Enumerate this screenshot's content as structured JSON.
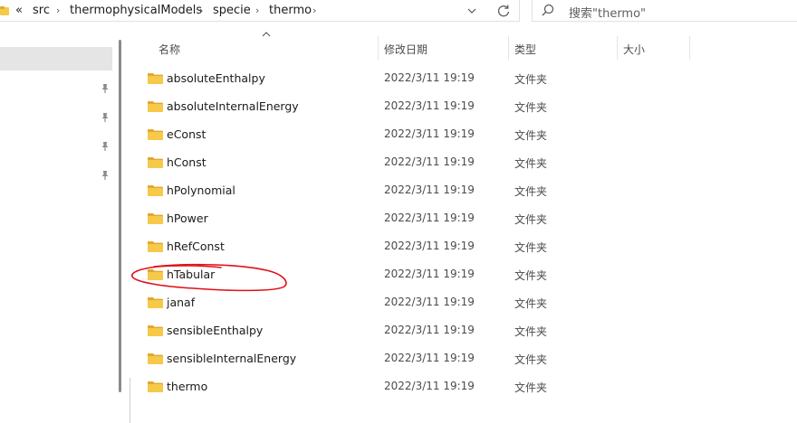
{
  "address": {
    "overflow": "«",
    "crumbs": [
      "src",
      "thermophysicalModels",
      "specie",
      "thermo"
    ]
  },
  "search": {
    "placeholder": "搜索\"thermo\""
  },
  "columns": {
    "name": "名称",
    "date": "修改日期",
    "type": "类型",
    "size": "大小"
  },
  "files": [
    {
      "name": "absoluteEnthalpy",
      "date": "2022/3/11 19:19",
      "type": "文件夹"
    },
    {
      "name": "absoluteInternalEnergy",
      "date": "2022/3/11 19:19",
      "type": "文件夹"
    },
    {
      "name": "eConst",
      "date": "2022/3/11 19:19",
      "type": "文件夹"
    },
    {
      "name": "hConst",
      "date": "2022/3/11 19:19",
      "type": "文件夹"
    },
    {
      "name": "hPolynomial",
      "date": "2022/3/11 19:19",
      "type": "文件夹"
    },
    {
      "name": "hPower",
      "date": "2022/3/11 19:19",
      "type": "文件夹"
    },
    {
      "name": "hRefConst",
      "date": "2022/3/11 19:19",
      "type": "文件夹"
    },
    {
      "name": "hTabular",
      "date": "2022/3/11 19:19",
      "type": "文件夹"
    },
    {
      "name": "janaf",
      "date": "2022/3/11 19:19",
      "type": "文件夹"
    },
    {
      "name": "sensibleEnthalpy",
      "date": "2022/3/11 19:19",
      "type": "文件夹"
    },
    {
      "name": "sensibleInternalEnergy",
      "date": "2022/3/11 19:19",
      "type": "文件夹"
    },
    {
      "name": "thermo",
      "date": "2022/3/11 19:19",
      "type": "文件夹"
    }
  ],
  "colors": {
    "folder": "#f7c948",
    "folder_dark": "#e0a82e",
    "annotation": "#e0101a"
  },
  "icons": {
    "crumb_folder": "folder-icon",
    "dropdown": "chevron-down-icon",
    "refresh": "refresh-icon",
    "search": "search-icon",
    "pin": "pin-icon",
    "sort": "sort-ascending-icon"
  }
}
